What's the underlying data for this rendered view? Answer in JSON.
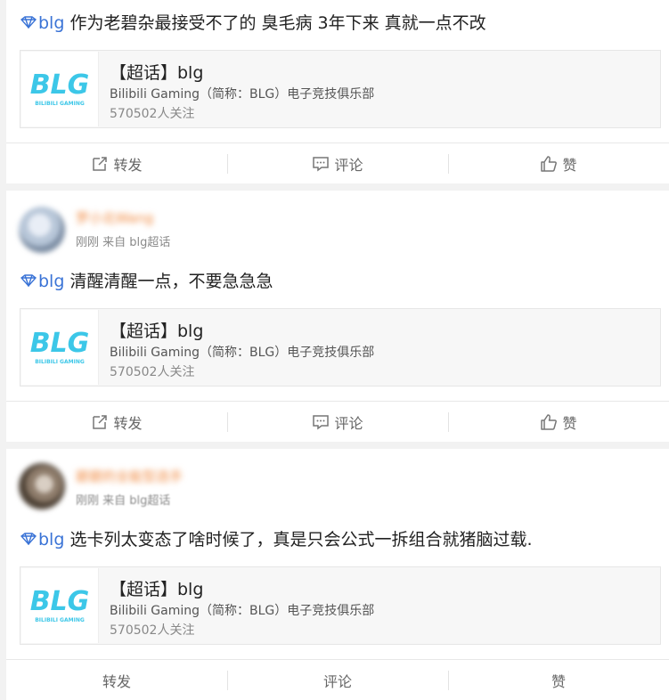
{
  "posts": [
    {
      "user": null,
      "tag": "blg",
      "text": " 作为老碧杂最接受不了的 臭毛病 3年下来 真就一点不改",
      "card": {
        "title": "【超话】blg",
        "desc": "Bilibili Gaming（简称：BLG）电子竞技俱乐部",
        "follow": "570502人关注",
        "logo_text": "BLG",
        "logo_sub": "BILIBILI GAMING"
      },
      "actions": {
        "repost": "转发",
        "comment": "评论",
        "like": "赞"
      }
    },
    {
      "user": {
        "name": "罗小北Wang",
        "meta": "刚刚 来自 blg超话"
      },
      "tag": "blg",
      "text": " 清醒清醒一点，不要急急急",
      "card": {
        "title": "【超话】blg",
        "desc": "Bilibili Gaming（简称：BLG）电子竞技俱乐部",
        "follow": "570502人关注",
        "logo_text": "BLG",
        "logo_sub": "BILIBILI GAMING"
      },
      "actions": {
        "repost": "转发",
        "comment": "评论",
        "like": "赞"
      }
    },
    {
      "user": {
        "name": "碧碧的全能型选手",
        "meta": "刚刚 来自 blg超话"
      },
      "tag": "blg",
      "text": " 选卡列太变态了啥时候了，真是只会公式一拆组合就猪脑过载.",
      "card": {
        "title": "【超话】blg",
        "desc": "Bilibili Gaming（简称：BLG）电子竞技俱乐部",
        "follow": "570502人关注",
        "logo_text": "BLG",
        "logo_sub": "BILIBILI GAMING"
      },
      "actions": {
        "repost": "转发",
        "comment": "评论",
        "like": "赞"
      }
    }
  ],
  "colors": {
    "tag": "#3a73d6",
    "logo": "#3cc7e8",
    "username": "#f0883e"
  }
}
